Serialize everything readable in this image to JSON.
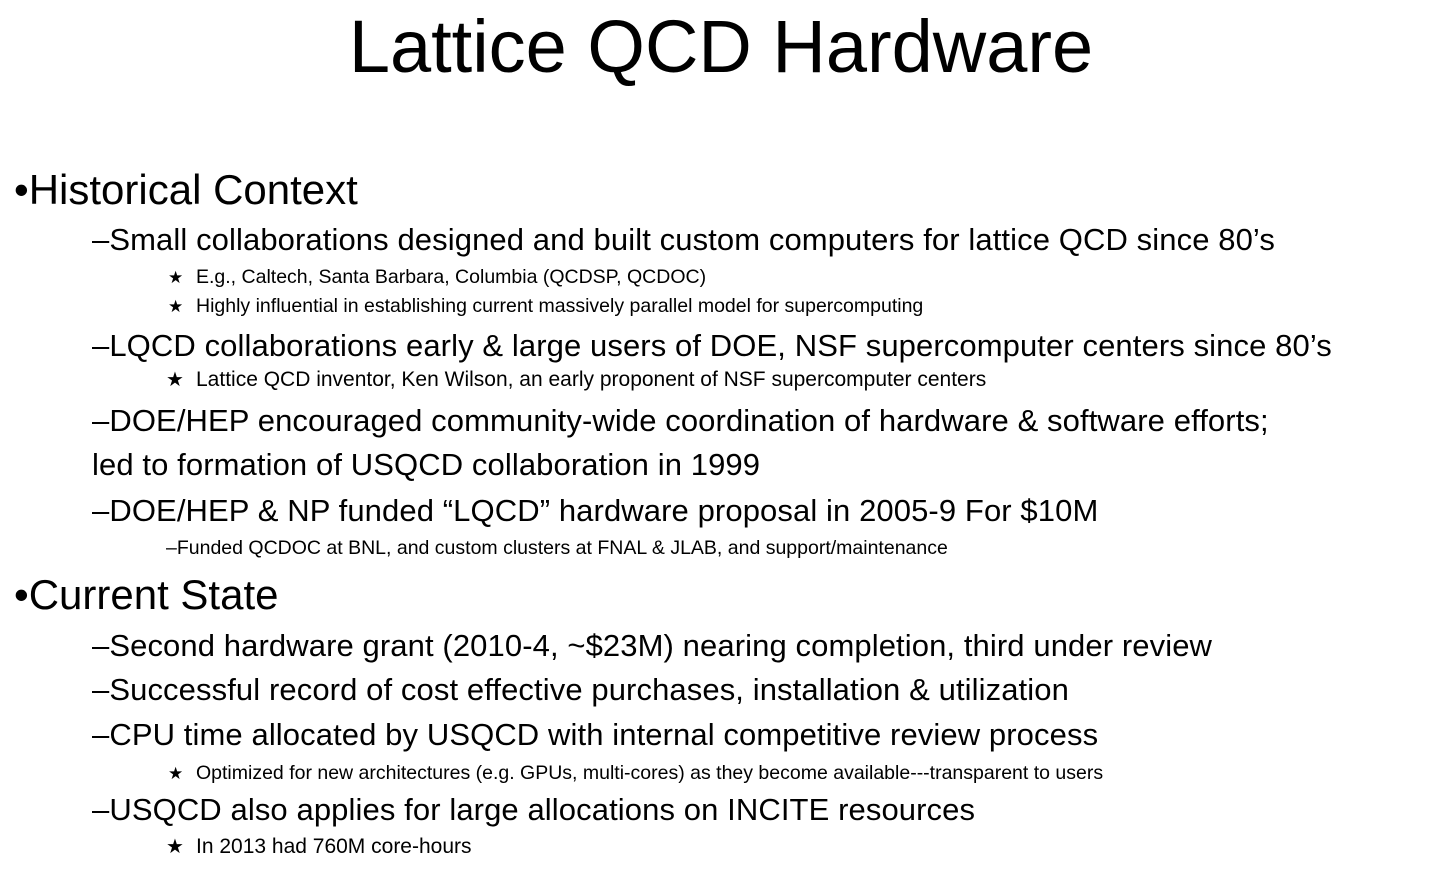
{
  "slide": {
    "title": "Lattice QCD Hardware",
    "sections": [
      {
        "heading": "•Historical Context",
        "items": [
          {
            "text": "–Small collaborations designed and built custom computers for lattice QCD since 80’s",
            "subs": [
              "E.g., Caltech, Santa Barbara, Columbia (QCDSP, QCDOC)",
              "Highly influential in establishing current massively parallel model for supercomputing"
            ]
          },
          {
            "text": "–LQCD collaborations early & large users of DOE, NSF supercomputer centers since 80’s",
            "subs": [
              "Lattice QCD inventor, Ken Wilson, an early proponent of NSF supercomputer centers"
            ]
          },
          {
            "text": "–DOE/HEP encouraged community-wide coordination of hardware & software efforts;",
            "continuation": "led to formation of USQCD collaboration in 1999"
          },
          {
            "text": "–DOE/HEP & NP funded “LQCD” hardware proposal  in 2005-9 For $10M",
            "dash_sub": "–Funded QCDOC at BNL, and custom clusters at FNAL & JLAB, and support/maintenance"
          }
        ]
      },
      {
        "heading": "•Current State",
        "items": [
          {
            "text": "–Second hardware grant (2010-4, ~$23M) nearing completion, third under review"
          },
          {
            "text": "–Successful record of cost effective purchases, installation & utilization"
          },
          {
            "text": "–CPU time allocated by USQCD with internal competitive review process",
            "subs": [
              "Optimized for new architectures (e.g. GPUs, multi-cores) as they become available---transparent to users"
            ]
          },
          {
            "text": "–USQCD also applies for large allocations on INCITE resources",
            "subs": [
              "In 2013 had 760M core-hours"
            ]
          }
        ]
      }
    ],
    "star_glyph": "★"
  }
}
